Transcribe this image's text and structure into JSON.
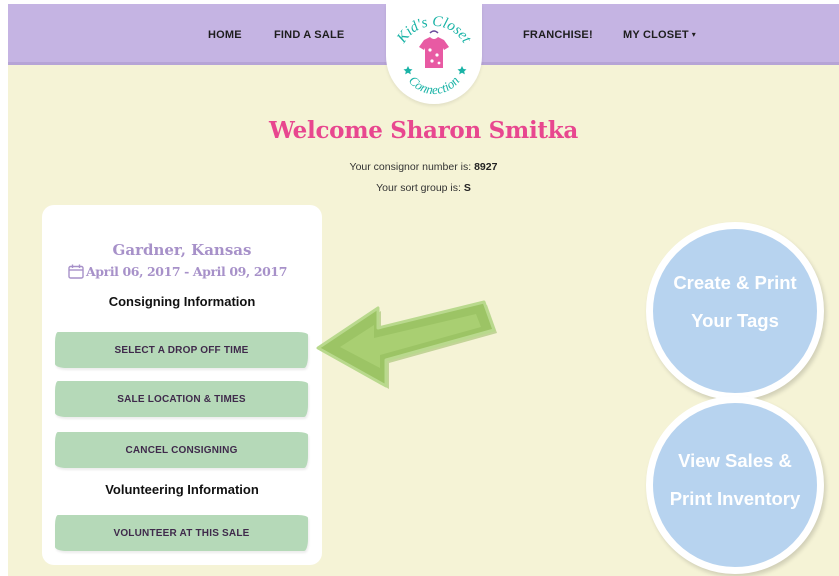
{
  "nav": {
    "home": "HOME",
    "find_sale": "FIND A SALE",
    "franchise": "FRANCHISE!",
    "my_closet": "MY CLOSET",
    "my_closet_caret": "▾"
  },
  "logo": {
    "line1": "Kid's Closet",
    "line2": "Connection",
    "icon": "tshirt-icon"
  },
  "welcome": {
    "title": "Welcome Sharon Smitka",
    "consignor_label": "Your consignor number is:",
    "consignor_number": "8927",
    "sort_label": "Your sort group is:",
    "sort_group": "S"
  },
  "sale_card": {
    "city": "Gardner, Kansas",
    "dates": "April 06, 2017 - April 09, 2017",
    "consigning_heading": "Consigning Information",
    "volunteering_heading": "Volunteering Information",
    "buttons": {
      "drop_off": "SELECT A DROP OFF TIME",
      "location": "SALE LOCATION & TIMES",
      "cancel": "CANCEL CONSIGNING",
      "volunteer": "VOLUNTEER AT THIS SALE"
    }
  },
  "circles": {
    "tags_line1": "Create & Print",
    "tags_line2": "Your Tags",
    "sales_line1": "View Sales &",
    "sales_line2": "Print Inventory"
  },
  "colors": {
    "page_background": "#f5f3d6",
    "nav_background": "#c5b4e3",
    "title_pink": "#e8478f",
    "card_purple": "#a791c9",
    "button_green": "#b5d9b8",
    "circle_blue": "#b7d3ef",
    "arrow_green": "#9cc465"
  }
}
